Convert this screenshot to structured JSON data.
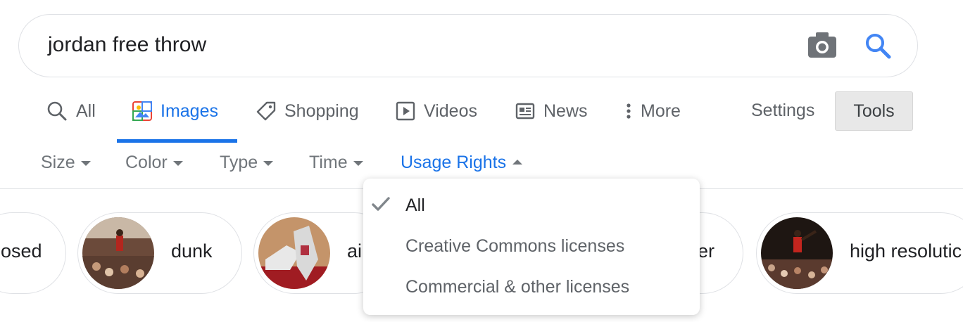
{
  "search": {
    "query": "jordan free throw",
    "camera_icon": "camera-icon",
    "search_icon": "magnifier-icon",
    "accent_color": "#1a73e8"
  },
  "tabs": [
    {
      "label": "All",
      "icon": "search-icon"
    },
    {
      "label": "Images",
      "icon": "image-icon",
      "active": true
    },
    {
      "label": "Shopping",
      "icon": "tag-icon"
    },
    {
      "label": "Videos",
      "icon": "play-icon"
    },
    {
      "label": "News",
      "icon": "newspaper-icon"
    },
    {
      "label": "More",
      "icon": "vertical-dots-icon"
    }
  ],
  "settings_label": "Settings",
  "tools_label": "Tools",
  "filters": [
    {
      "label": "Size"
    },
    {
      "label": "Color"
    },
    {
      "label": "Type"
    },
    {
      "label": "Time"
    },
    {
      "label": "Usage Rights",
      "open": true
    }
  ],
  "chips": [
    {
      "label": "osed"
    },
    {
      "label": "dunk"
    },
    {
      "label": "ai"
    },
    {
      "label": "er"
    },
    {
      "label": "high resolutic"
    }
  ],
  "usage_rights_menu": {
    "items": [
      {
        "label": "All",
        "selected": true
      },
      {
        "label": "Creative Commons licenses"
      },
      {
        "label": "Commercial & other licenses"
      }
    ]
  }
}
